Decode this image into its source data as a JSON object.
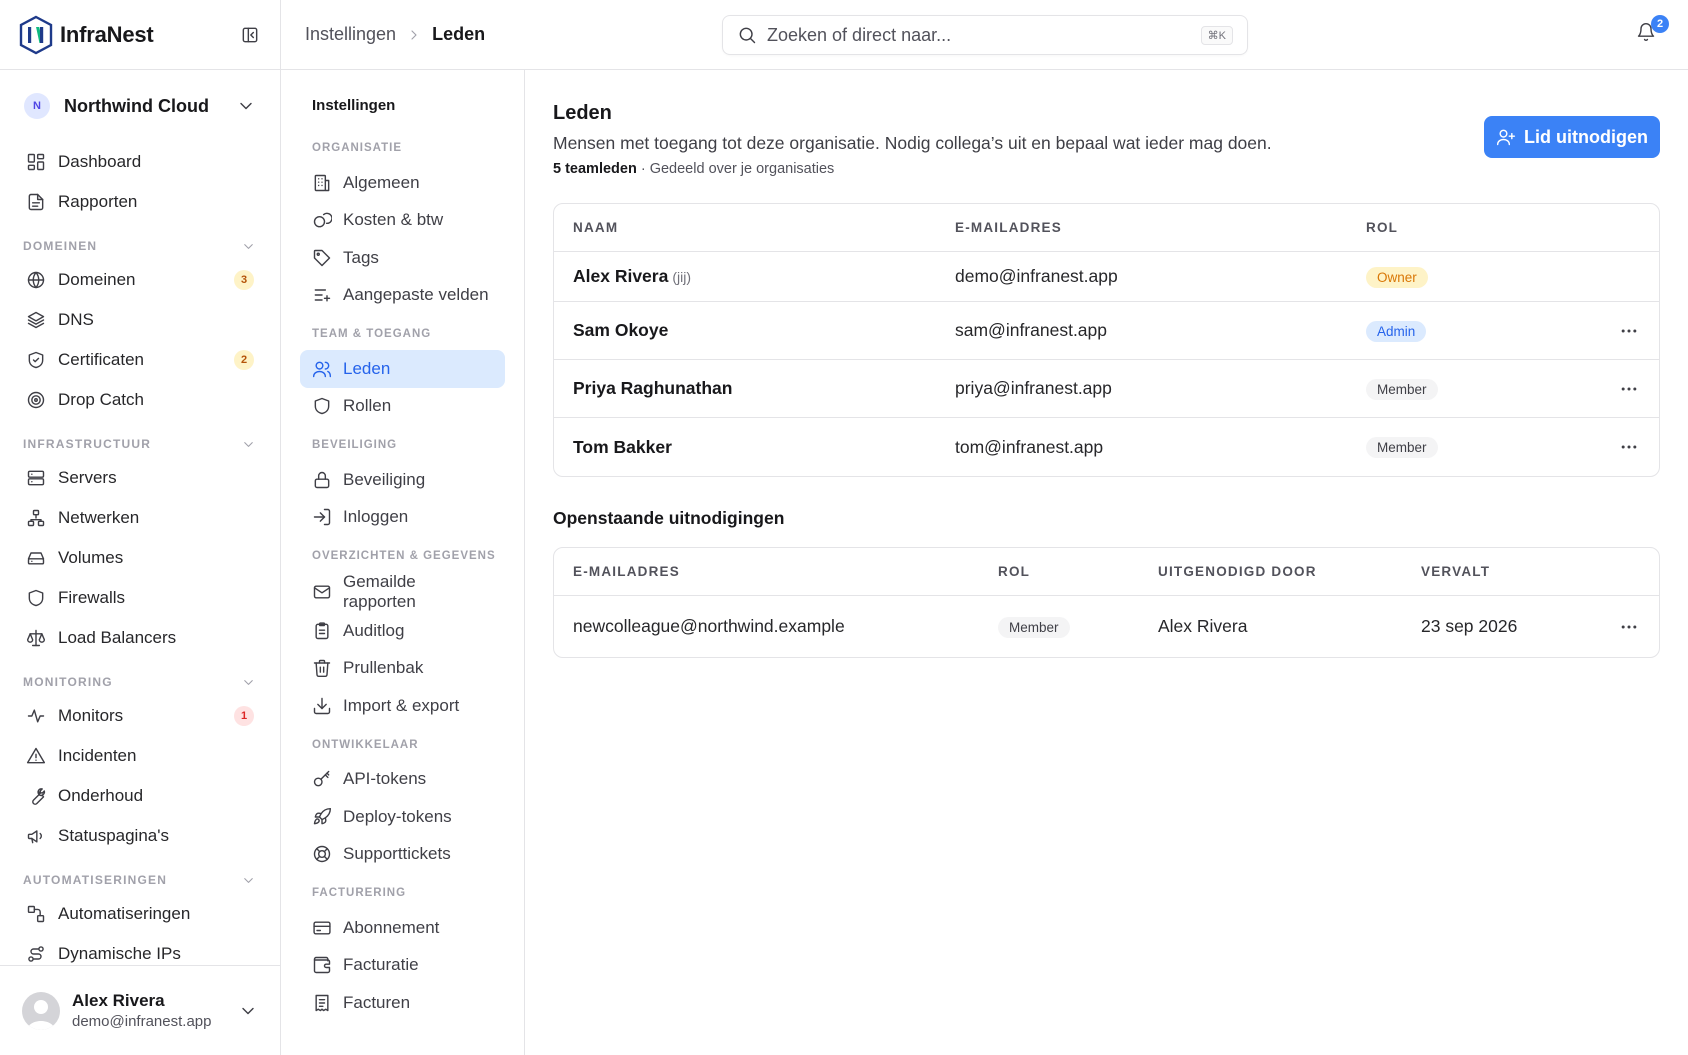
{
  "brand": {
    "name": "InfraNest"
  },
  "org": {
    "initial": "N",
    "name": "Northwind Cloud"
  },
  "sidebar": {
    "top_items": [
      {
        "label": "Dashboard",
        "icon": "dashboard-icon"
      },
      {
        "label": "Rapporten",
        "icon": "report-icon"
      }
    ],
    "sections": [
      {
        "title": "DOMEINEN",
        "items": [
          {
            "label": "Domeinen",
            "icon": "globe-icon",
            "badge": "3",
            "badge_color": "amber"
          },
          {
            "label": "DNS",
            "icon": "layers-icon"
          },
          {
            "label": "Certificaten",
            "icon": "shield-check-icon",
            "badge": "2",
            "badge_color": "amber"
          },
          {
            "label": "Drop Catch",
            "icon": "target-icon"
          }
        ]
      },
      {
        "title": "INFRASTRUCTUUR",
        "items": [
          {
            "label": "Servers",
            "icon": "server-icon"
          },
          {
            "label": "Netwerken",
            "icon": "network-icon"
          },
          {
            "label": "Volumes",
            "icon": "drive-icon"
          },
          {
            "label": "Firewalls",
            "icon": "shield-icon"
          },
          {
            "label": "Load Balancers",
            "icon": "scale-icon"
          }
        ]
      },
      {
        "title": "MONITORING",
        "items": [
          {
            "label": "Monitors",
            "icon": "activity-icon",
            "badge": "1",
            "badge_color": "red"
          },
          {
            "label": "Incidenten",
            "icon": "alert-triangle-icon"
          },
          {
            "label": "Onderhoud",
            "icon": "wrench-icon"
          },
          {
            "label": "Statuspagina's",
            "icon": "megaphone-icon"
          }
        ]
      },
      {
        "title": "AUTOMATISERINGEN",
        "items": [
          {
            "label": "Automatiseringen",
            "icon": "workflow-icon"
          },
          {
            "label": "Dynamische IPs",
            "icon": "route-icon"
          }
        ]
      }
    ]
  },
  "user": {
    "name": "Alex Rivera",
    "email": "demo@infranest.app"
  },
  "topbar": {
    "breadcrumb": [
      "Instellingen",
      "Leden"
    ],
    "search_placeholder": "Zoeken of direct naar...",
    "search_shortcut": "⌘K",
    "notification_count": "2"
  },
  "settings_nav": {
    "title": "Instellingen",
    "sections": [
      {
        "title": "ORGANISATIE",
        "items": [
          {
            "label": "Algemeen",
            "icon": "building-icon"
          },
          {
            "label": "Kosten & btw",
            "icon": "coins-icon"
          },
          {
            "label": "Tags",
            "icon": "tag-icon"
          },
          {
            "label": "Aangepaste velden",
            "icon": "list-plus-icon"
          }
        ]
      },
      {
        "title": "TEAM & TOEGANG",
        "items": [
          {
            "label": "Leden",
            "icon": "users-icon",
            "active": true
          },
          {
            "label": "Rollen",
            "icon": "shield-icon"
          }
        ]
      },
      {
        "title": "BEVEILIGING",
        "items": [
          {
            "label": "Beveiliging",
            "icon": "lock-icon"
          },
          {
            "label": "Inloggen",
            "icon": "login-icon"
          }
        ]
      },
      {
        "title": "OVERZICHTEN & GEGEVENS",
        "items": [
          {
            "label": "Gemailde rapporten",
            "icon": "mail-icon"
          },
          {
            "label": "Auditlog",
            "icon": "clipboard-icon"
          },
          {
            "label": "Prullenbak",
            "icon": "trash-icon"
          },
          {
            "label": "Import & export",
            "icon": "download-icon"
          }
        ]
      },
      {
        "title": "ONTWIKKELAAR",
        "items": [
          {
            "label": "API-tokens",
            "icon": "key-icon"
          },
          {
            "label": "Deploy-tokens",
            "icon": "rocket-icon"
          },
          {
            "label": "Supporttickets",
            "icon": "lifebuoy-icon"
          }
        ]
      },
      {
        "title": "FACTURERING",
        "items": [
          {
            "label": "Abonnement",
            "icon": "credit-card-icon"
          },
          {
            "label": "Facturatie",
            "icon": "wallet-icon"
          },
          {
            "label": "Facturen",
            "icon": "receipt-icon"
          }
        ]
      }
    ]
  },
  "page": {
    "title": "Leden",
    "description": "Mensen met toegang tot deze organisatie. Nodig collega’s uit en bepaal wat ieder mag doen.",
    "member_count": "5 teamleden",
    "meta_suffix": " · Gedeeld over je organisaties",
    "invite_label": "Lid uitnodigen"
  },
  "members_table": {
    "headers": [
      "NAAM",
      "E-MAILADRES",
      "ROL"
    ],
    "rows": [
      {
        "name": "Alex Rivera",
        "you": "(jij)",
        "email": "demo@infranest.app",
        "role": "Owner",
        "role_style": "owner",
        "actions": false
      },
      {
        "name": "Sam Okoye",
        "email": "sam@infranest.app",
        "role": "Admin",
        "role_style": "admin",
        "actions": true
      },
      {
        "name": "Priya Raghunathan",
        "email": "priya@infranest.app",
        "role": "Member",
        "role_style": "member",
        "actions": true
      },
      {
        "name": "Tom Bakker",
        "email": "tom@infranest.app",
        "role": "Member",
        "role_style": "member",
        "actions": true
      }
    ]
  },
  "pending": {
    "title": "Openstaande uitnodigingen",
    "headers": [
      "E-MAILADRES",
      "ROL",
      "UITGENODIGD DOOR",
      "VERVALT"
    ],
    "rows": [
      {
        "email": "newcolleague@northwind.example",
        "role": "Member",
        "invited_by": "Alex Rivera",
        "expires": "23 sep 2026"
      }
    ]
  },
  "colors": {
    "accent": "#3b82f6",
    "active_bg": "#dbeafe",
    "owner": "#d97706",
    "admin": "#2563eb"
  }
}
